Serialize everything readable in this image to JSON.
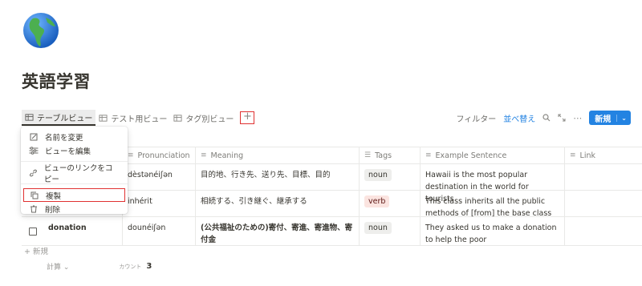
{
  "page": {
    "title": "英語学習",
    "icon": "globe-americas-icon"
  },
  "views": [
    {
      "label": "テーブルビュー",
      "icon": "table-icon",
      "active": true
    },
    {
      "label": "テスト用ビュー",
      "icon": "table-icon"
    },
    {
      "label": "タグ別ビュー",
      "icon": "table-icon"
    }
  ],
  "add_view_label": "+",
  "toolbar": {
    "filter": "フィルター",
    "sort": "並べ替え",
    "search_icon": "search-icon",
    "expand_icon": "expand-icon",
    "more_icon": "more-icon",
    "new_label": "新規",
    "new_arrow": "⌄"
  },
  "context_menu": {
    "items": [
      {
        "label": "名前を変更",
        "icon": "edit-icon"
      },
      {
        "label": "ビューを編集",
        "icon": "sliders-icon"
      },
      {
        "label": "ビューのリンクをコピー",
        "icon": "link-icon"
      },
      {
        "label": "複製",
        "icon": "duplicate-icon",
        "highlighted": true
      },
      {
        "label": "削除",
        "icon": "trash-icon"
      }
    ]
  },
  "table": {
    "columns": [
      {
        "label": "Pronunciation",
        "icon": "text-icon"
      },
      {
        "label": "Meaning",
        "icon": "text-icon"
      },
      {
        "label": "Tags",
        "icon": "list-icon"
      },
      {
        "label": "Example Sentence",
        "icon": "text-icon"
      },
      {
        "label": "Link",
        "icon": "text-icon"
      }
    ],
    "rows": [
      {
        "word": "",
        "pronunciation": "dèstənéiʃən",
        "meaning": "目的地、行き先、送り先、目標、目的",
        "tag": "noun",
        "example": "Hawaii is the most popular destination in the world for tourists"
      },
      {
        "word": "",
        "pronunciation": "inhérit",
        "meaning": "相続する、引き継ぐ、継承する",
        "tag": "verb",
        "example": "This class inherits all the public methods of [from] the base class"
      },
      {
        "word": "donation",
        "pronunciation": "dounéiʃən",
        "meaning": "(公共福祉のための)寄付、寄進、寄進物、寄付金",
        "tag": "noun",
        "example": "They asked us to make a donation to help the poor"
      }
    ]
  },
  "footer": {
    "new_row": "+ 新規",
    "calc": "計算 ⌄",
    "count_label": "カウント",
    "count_value": "3"
  },
  "colors": {
    "accent": "#2383e2",
    "highlight": "#e03131",
    "verb_tag_bg": "#fbe4e0",
    "noun_tag_bg": "#eeeeec"
  }
}
